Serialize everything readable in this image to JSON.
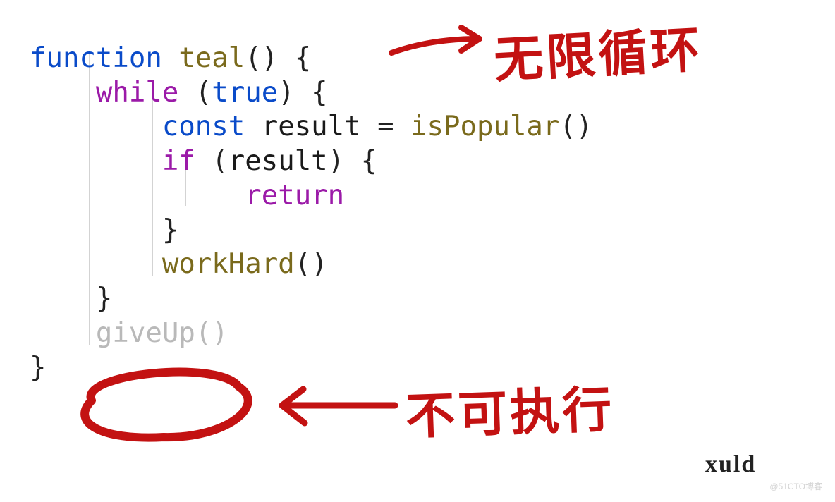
{
  "code": {
    "line1": {
      "kw_function": "function",
      "fn_name": "teal",
      "open": "()",
      "brace": " {"
    },
    "line2": {
      "kw_while": "while",
      "paren_open": " (",
      "kw_true": "true",
      "paren_close": ")",
      "brace": " {"
    },
    "line3": {
      "kw_const": "const",
      "var": " result ",
      "op": "=",
      "sp": " ",
      "call": "isPopular",
      "parens": "()"
    },
    "line4": {
      "kw_if": "if",
      "paren_open": " (",
      "var": "result",
      "paren_close": ")",
      "brace": " {"
    },
    "line5": {
      "kw_return": "return"
    },
    "line6": {
      "brace": "}"
    },
    "line7": {
      "call": "workHard",
      "parens": "()"
    },
    "line8": {
      "brace": "}"
    },
    "line9": {
      "dead_call": "giveUp",
      "dead_parens": "()"
    },
    "line10": {
      "brace": "}"
    }
  },
  "annotations": {
    "top": "无限循环",
    "bottom": "不可执行",
    "signature": "xuld"
  },
  "watermark": "@51CTO博客"
}
